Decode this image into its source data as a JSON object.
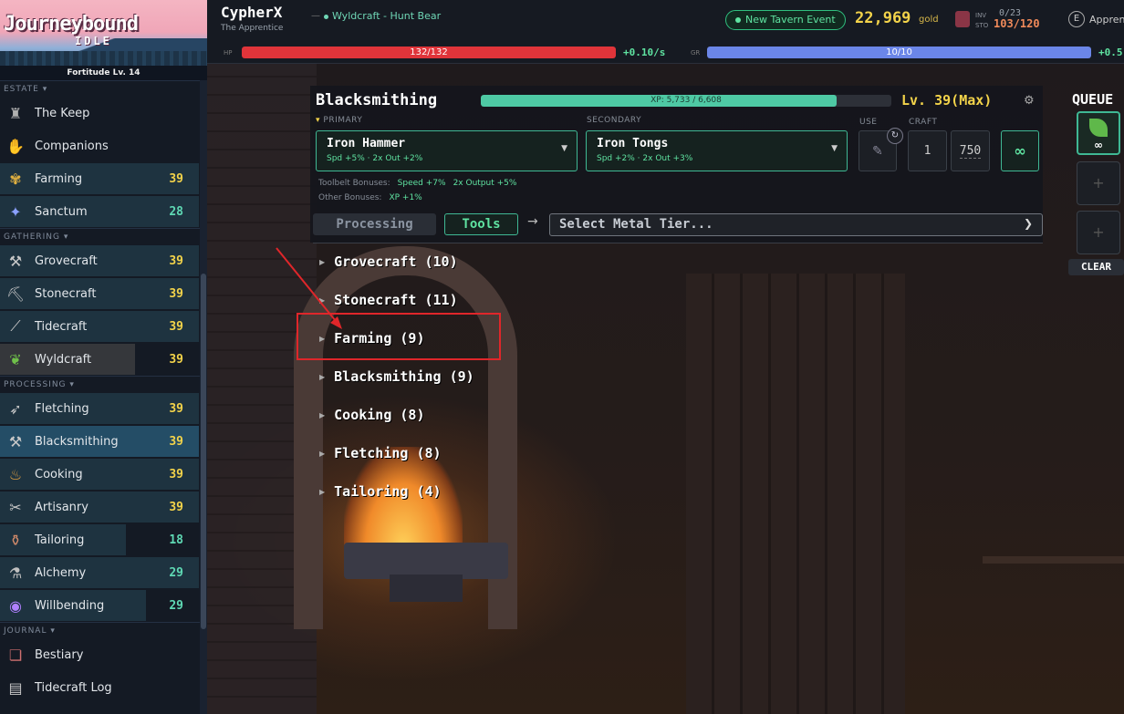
{
  "sidebar": {
    "logo_title": "Journeybound",
    "logo_subtitle": "IDLE",
    "fortitude": "Fortitude Lv. 14",
    "sections": [
      {
        "label": "ESTATE ▾",
        "items": [
          {
            "label": "The Keep",
            "level": "",
            "icon": "keep-icon"
          },
          {
            "label": "Companions",
            "level": "",
            "icon": "companions-icon"
          },
          {
            "label": "Farming",
            "level": "39",
            "icon": "farming-icon"
          },
          {
            "label": "Sanctum",
            "level": "28",
            "icon": "sanctum-icon"
          }
        ]
      },
      {
        "label": "GATHERING ▾",
        "items": [
          {
            "label": "Grovecraft",
            "level": "39",
            "icon": "grovecraft-icon"
          },
          {
            "label": "Stonecraft",
            "level": "39",
            "icon": "stonecraft-icon"
          },
          {
            "label": "Tidecraft",
            "level": "39",
            "icon": "tidecraft-icon"
          },
          {
            "label": "Wyldcraft",
            "level": "39",
            "icon": "wyldcraft-icon"
          }
        ]
      },
      {
        "label": "PROCESSING ▾",
        "items": [
          {
            "label": "Fletching",
            "level": "39",
            "icon": "fletching-icon"
          },
          {
            "label": "Blacksmithing",
            "level": "39",
            "icon": "blacksmithing-icon"
          },
          {
            "label": "Cooking",
            "level": "39",
            "icon": "cooking-icon"
          },
          {
            "label": "Artisanry",
            "level": "39",
            "icon": "artisanry-icon"
          },
          {
            "label": "Tailoring",
            "level": "18",
            "icon": "tailoring-icon"
          },
          {
            "label": "Alchemy",
            "level": "29",
            "icon": "alchemy-icon"
          },
          {
            "label": "Willbending",
            "level": "29",
            "icon": "willbending-icon"
          }
        ]
      },
      {
        "label": "JOURNAL ▾",
        "items": [
          {
            "label": "Bestiary",
            "level": "",
            "icon": "bestiary-icon"
          },
          {
            "label": "Tidecraft Log",
            "level": "",
            "icon": "tidecraft-log-icon"
          }
        ]
      }
    ]
  },
  "header": {
    "player_name": "CypherX",
    "dash": "—",
    "activity": "Wyldcraft - Hunt Bear",
    "player_title": "The Apprentice",
    "tavern": "New Tavern Event",
    "gold": "22,969",
    "gold_label": "gold",
    "inv_label": "INV",
    "sto_label": "STO",
    "inv_value": "0/23",
    "sto_value": "103/120",
    "apprentice_icon": "E",
    "apprentice_label": "Appren",
    "hp_label": "HP",
    "hp_text": "132/132",
    "hp_fraction": 1.0,
    "hp_rate": "+0.10/s",
    "gr_label": "GR",
    "gr_text": "10/10",
    "gr_fraction": 1.0,
    "gr_rate": "+0.5"
  },
  "panel": {
    "skill": "Blacksmithing",
    "xp_text": "XP: 5,733 / 6,608",
    "xp_fraction": 0.8676,
    "level": "Lv. 39(Max)",
    "primary_label": "PRIMARY",
    "secondary_label": "SECONDARY",
    "use_label": "USE",
    "craft_label": "CRAFT",
    "primary_tool": "Iron Hammer",
    "primary_stats": "Spd +5% · 2x Out +2%",
    "secondary_tool": "Iron Tongs",
    "secondary_stats": "Spd +2% · 2x Out +3%",
    "craft_qty": "1",
    "craft_max": "750",
    "infinite": "∞",
    "toolbelt_label": "Toolbelt Bonuses:",
    "toolbelt_speed": "Speed +7%",
    "toolbelt_output": "2x Output +5%",
    "other_label": "Other Bonuses:",
    "other_xp": "XP +1%",
    "tab_processing": "Processing",
    "tab_tools": "Tools",
    "arrow": "→",
    "tier_placeholder": "Select Metal Tier...",
    "categories": [
      "Grovecraft (10)",
      "Stonecraft (11)",
      "Farming (9)",
      "Blacksmithing (9)",
      "Cooking (8)",
      "Fletching (8)",
      "Tailoring (4)"
    ]
  },
  "queue": {
    "title": "QUEUE",
    "slot1_count": "∞",
    "add": "+",
    "clear": "CLEAR"
  },
  "colors": {
    "accent": "#3fb894",
    "gold": "#f3d34a",
    "hp": "#e0343a",
    "gr": "#6b86e8",
    "annotation": "#e0262a"
  }
}
